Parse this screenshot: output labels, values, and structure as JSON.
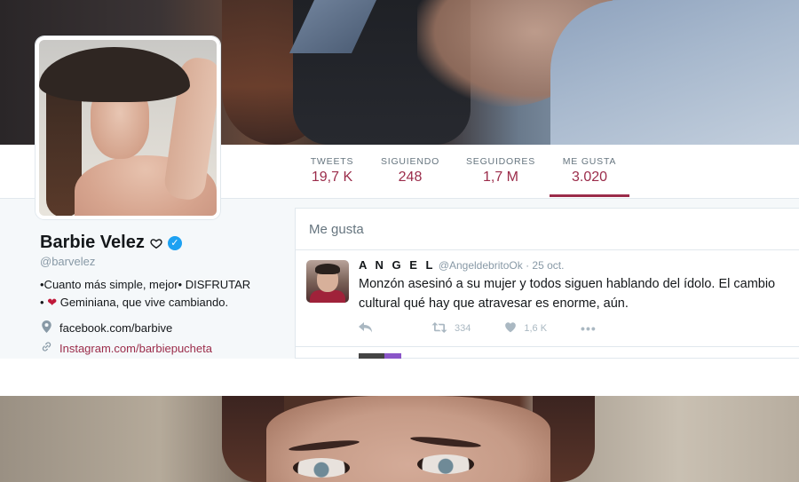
{
  "profile": {
    "name": "Barbie Velez",
    "handle": "@barvelez",
    "bio_line1": "•Cuanto más simple, mejor• DISFRUTAR",
    "bio_line2_prefix": "•",
    "bio_line2": "Geminiana, que vive cambiando.",
    "website": "facebook.com/barbive",
    "link": "Instagram.com/barbiepucheta"
  },
  "stats": [
    {
      "label": "TWEETS",
      "value": "19,7 K"
    },
    {
      "label": "SIGUIENDO",
      "value": "248"
    },
    {
      "label": "SEGUIDORES",
      "value": "1,7 M"
    },
    {
      "label": "ME GUSTA",
      "value": "3.020"
    }
  ],
  "panel": {
    "title": "Me gusta"
  },
  "tweet": {
    "author": "A N G E L",
    "handle": "@AngeldebritoOk",
    "separator": "·",
    "date": "25 oct.",
    "text": "Monzón asesinó a su mujer y todos siguen hablando del ídolo. El cambio cultural qué hay que atravesar es enorme, aún.",
    "retweets": "334",
    "likes": "1,6 K"
  },
  "icons": {
    "verified": "verified-badge-icon",
    "heart_outline": "heart-outline-icon",
    "heart": "heart-icon",
    "location": "location-pin-icon",
    "link": "link-icon",
    "reply": "reply-icon",
    "retweet": "retweet-icon",
    "like": "like-icon",
    "more": "more-icon"
  },
  "colors": {
    "accent": "#9b2c4a",
    "link": "#9b2c4a",
    "verified": "#1da1f2"
  }
}
